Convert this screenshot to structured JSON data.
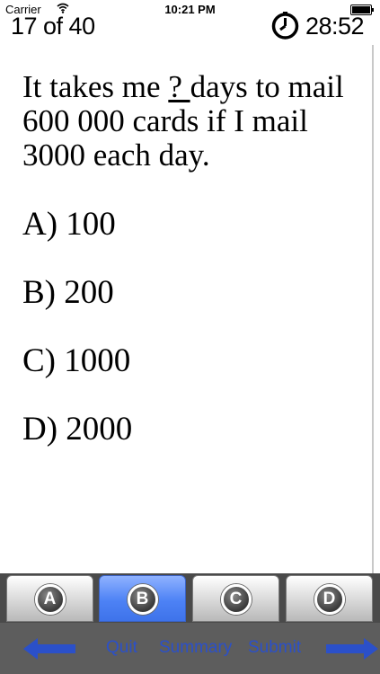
{
  "status_bar": {
    "carrier": "Carrier",
    "time": "10:21 PM"
  },
  "header": {
    "progress": "17 of 40",
    "timer": "28:52"
  },
  "question": {
    "before": "It takes me ",
    "blank": " ? ",
    "after": " days to mail 600 000 cards if I mail 3000 each day."
  },
  "answers": [
    "A) 100",
    "B) 200",
    "C) 1000",
    "D) 2000"
  ],
  "choice_buttons": [
    {
      "letter": "A",
      "selected": false
    },
    {
      "letter": "B",
      "selected": true
    },
    {
      "letter": "C",
      "selected": false
    },
    {
      "letter": "D",
      "selected": false
    }
  ],
  "nav": {
    "quit": "Quit",
    "summary": "Summary",
    "submit": "Submit"
  },
  "colors": {
    "selected": "#4d82f5",
    "nav_text": "#2b50c9",
    "nav_bar": "#5d5d5d"
  },
  "icons": {
    "wifi": "wifi-icon",
    "battery": "battery-icon",
    "timer": "stopwatch-icon",
    "prev": "arrow-left-icon",
    "next": "arrow-right-icon"
  }
}
